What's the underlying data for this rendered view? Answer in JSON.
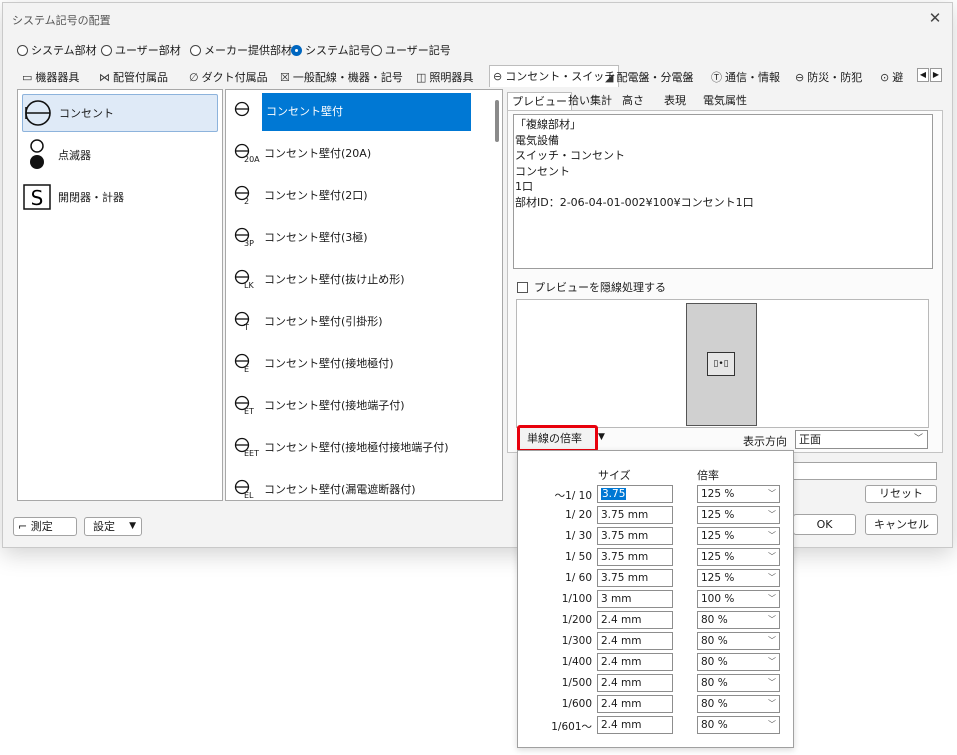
{
  "window": {
    "title": "システム記号の配置"
  },
  "radios": [
    {
      "label": "システム部材",
      "checked": false
    },
    {
      "label": "ユーザー部材",
      "checked": false
    },
    {
      "label": "メーカー提供部材",
      "checked": false
    },
    {
      "label": "システム記号",
      "checked": true
    },
    {
      "label": "ユーザー記号",
      "checked": false
    }
  ],
  "tabs": [
    {
      "icon": "▭",
      "label": "機器器具"
    },
    {
      "icon": "⋈",
      "label": "配管付属品"
    },
    {
      "icon": "∅",
      "label": "ダクト付属品"
    },
    {
      "icon": "☒",
      "label": "一般配線・機器・記号"
    },
    {
      "icon": "◫",
      "label": "照明器具"
    },
    {
      "icon": "⊖",
      "label": "コンセント・スイッチ"
    },
    {
      "icon": "◢",
      "label": "配電盤・分電盤"
    },
    {
      "icon": "Ⓣ",
      "label": "通信・情報"
    },
    {
      "icon": "⊖",
      "label": "防災・防犯"
    },
    {
      "icon": "⊙",
      "label": "避"
    }
  ],
  "categories": [
    {
      "label": "コンセント"
    },
    {
      "label": "点滅器"
    },
    {
      "label": "開閉器・計器"
    }
  ],
  "items": [
    {
      "sub": "",
      "label": "コンセント壁付"
    },
    {
      "sub": "20A",
      "label": "コンセント壁付(20A)"
    },
    {
      "sub": "2",
      "label": "コンセント壁付(2口)"
    },
    {
      "sub": "3P",
      "label": "コンセント壁付(3極)"
    },
    {
      "sub": "LK",
      "label": "コンセント壁付(抜け止め形)"
    },
    {
      "sub": "T",
      "label": "コンセント壁付(引掛形)"
    },
    {
      "sub": "E",
      "label": "コンセント壁付(接地極付)"
    },
    {
      "sub": "ET",
      "label": "コンセント壁付(接地端子付)"
    },
    {
      "sub": "EET",
      "label": "コンセント壁付(接地極付接地端子付)"
    },
    {
      "sub": "EL",
      "label": "コンセント壁付(漏電遮断器付)"
    }
  ],
  "right_tabs": [
    "プレビュー",
    "拾い集計",
    "高さ",
    "表現",
    "電気属性"
  ],
  "preview_lines": [
    "「複線部材」",
    "電気設備",
    "スイッチ・コンセント",
    "コンセント",
    "1口",
    "部材ID：2-06-04-01-002¥100¥コンセント1口"
  ],
  "hidden_line_label": "プレビューを隠線処理する",
  "plate_symbol": "▯•▯",
  "scale_button": "単線の倍率",
  "direction": {
    "label": "表示方向",
    "value": "正面"
  },
  "reset_label": "リセット",
  "ok_label": "OK",
  "cancel_label": "キャンセル",
  "measure_label": "測定",
  "settings_label": "設定",
  "popup": {
    "col_size": "サイズ",
    "col_rate": "倍率",
    "rows": [
      {
        "scale": "～1/ 10",
        "size": "3.75",
        "rate": "125 %"
      },
      {
        "scale": "1/ 20",
        "size": "3.75 mm",
        "rate": "125 %"
      },
      {
        "scale": "1/ 30",
        "size": "3.75 mm",
        "rate": "125 %"
      },
      {
        "scale": "1/ 50",
        "size": "3.75 mm",
        "rate": "125 %"
      },
      {
        "scale": "1/ 60",
        "size": "3.75 mm",
        "rate": "125 %"
      },
      {
        "scale": "1/100",
        "size": "3 mm",
        "rate": "100 %"
      },
      {
        "scale": "1/200",
        "size": "2.4 mm",
        "rate": "80 %"
      },
      {
        "scale": "1/300",
        "size": "2.4 mm",
        "rate": "80 %"
      },
      {
        "scale": "1/400",
        "size": "2.4 mm",
        "rate": "80 %"
      },
      {
        "scale": "1/500",
        "size": "2.4 mm",
        "rate": "80 %"
      },
      {
        "scale": "1/600",
        "size": "2.4 mm",
        "rate": "80 %"
      },
      {
        "scale": "1/601～",
        "size": "2.4 mm",
        "rate": "80 %"
      }
    ]
  }
}
